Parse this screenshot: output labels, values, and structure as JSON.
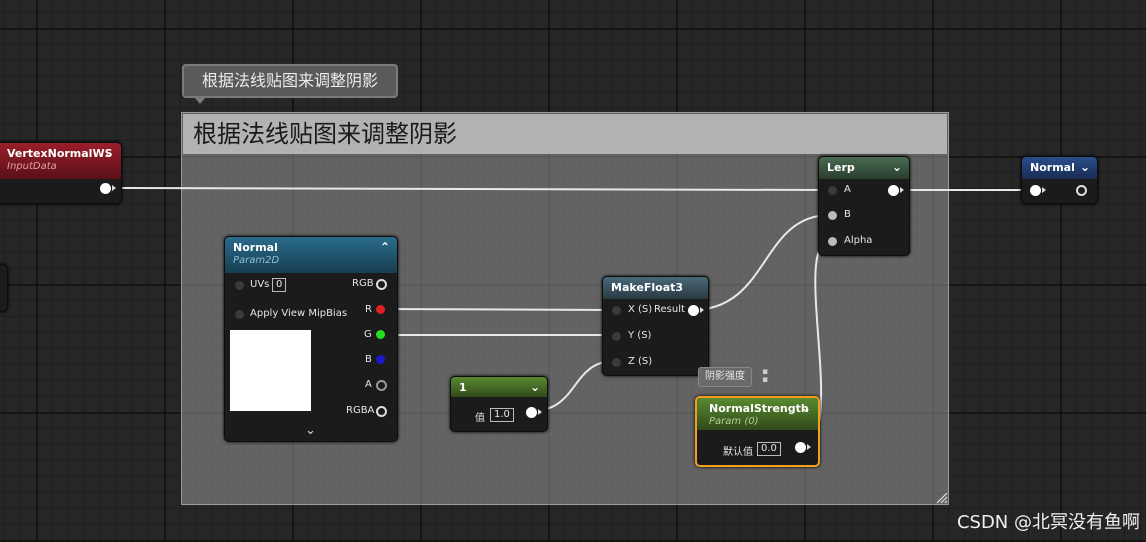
{
  "comment": {
    "bubble": "根据法线贴图来调整阴影",
    "title": "根据法线贴图来调整阴影"
  },
  "nodes": {
    "vertex_normal": {
      "title": "VertexNormalWS",
      "subtitle": "InputData"
    },
    "normal_tex": {
      "title": "Normal",
      "subtitle": "Param2D",
      "uvs_label": "UVs",
      "uvs_value": "0",
      "mipbias_label": "Apply View MipBias",
      "outputs": [
        "RGB",
        "R",
        "G",
        "B",
        "A",
        "RGBA"
      ]
    },
    "makefloat3": {
      "title": "MakeFloat3",
      "inputs": [
        "X (S)",
        "Y (S)",
        "Z (S)"
      ],
      "output": "Result"
    },
    "const1": {
      "title": "1",
      "value_label": "值",
      "value": "1.0"
    },
    "lerp": {
      "title": "Lerp",
      "inputs": [
        "A",
        "B",
        "Alpha"
      ]
    },
    "normal_output": {
      "title": "Normal"
    },
    "normal_strength": {
      "title": "NormalStrength",
      "subtitle": "Param (0)",
      "default_label": "默认值",
      "default_value": "0.0"
    },
    "tooltip_label": "阴影强度"
  },
  "watermark": "CSDN @北冥没有鱼啊",
  "colors": {
    "red_pin": "#e02020",
    "green_pin": "#22e022",
    "blue_pin": "#1a1acc",
    "selected_border": "#f0a020"
  }
}
